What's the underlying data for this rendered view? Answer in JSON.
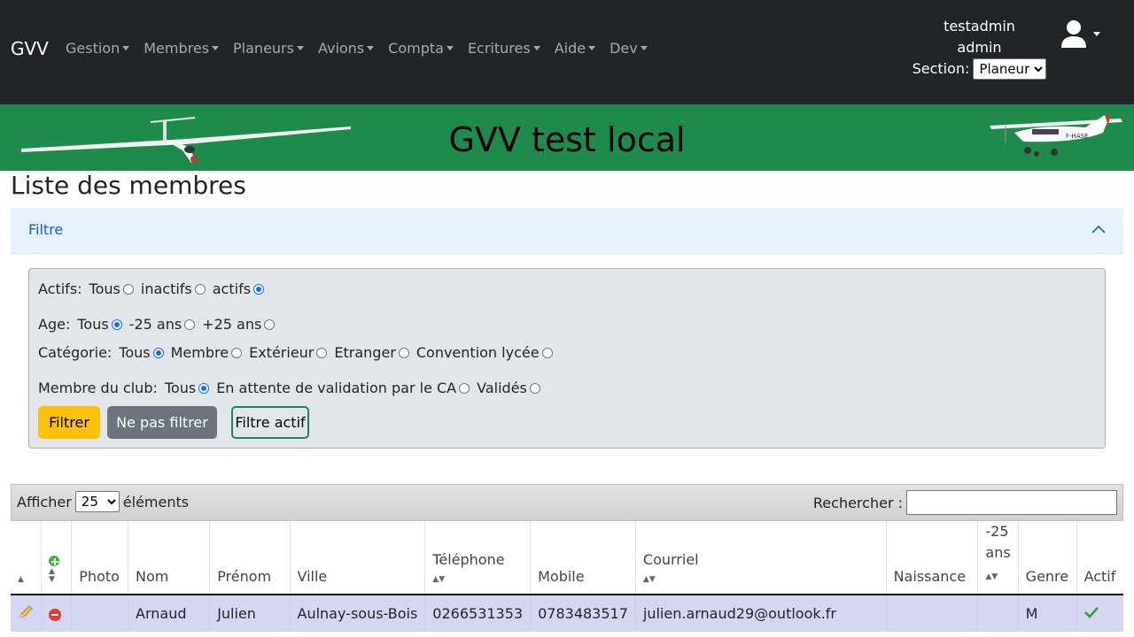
{
  "navbar": {
    "brand": "GVV",
    "menu": [
      "Gestion",
      "Membres",
      "Planeurs",
      "Avions",
      "Compta",
      "Ecritures",
      "Aide",
      "Dev"
    ],
    "user_name": "testadmin",
    "user_role": "admin",
    "section_label": "Section:",
    "section_value": "Planeur"
  },
  "banner": {
    "title": "GVV test local",
    "plane_registration": "F-HASE"
  },
  "page": {
    "title": "Liste des membres"
  },
  "filter": {
    "header": "Filtre",
    "actifs": {
      "label": "Actifs:",
      "options": [
        "Tous",
        "inactifs",
        "actifs"
      ],
      "selected": "actifs"
    },
    "age": {
      "label": "Age:",
      "options": [
        "Tous",
        "-25 ans",
        "+25 ans"
      ],
      "selected": "Tous"
    },
    "categorie": {
      "label": "Catégorie:",
      "options": [
        "Tous",
        "Membre",
        "Extérieur",
        "Etranger",
        "Convention lycée"
      ],
      "selected": "Tous"
    },
    "membre_club": {
      "label": "Membre du club:",
      "options": [
        "Tous",
        "En attente de validation par le CA",
        "Validés"
      ],
      "selected": "Tous"
    },
    "buttons": {
      "filter": "Filtrer",
      "no_filter": "Ne pas filtrer",
      "active": "Filtre actif"
    }
  },
  "table_controls": {
    "show_label": "Afficher",
    "show_value": "25",
    "elements_label": "éléments",
    "search_label": "Rechercher :"
  },
  "table": {
    "headers": [
      "Photo",
      "Nom",
      "Prénom",
      "Ville",
      "Téléphone",
      "Mobile",
      "Courriel",
      "Naissance",
      "-25 ans",
      "Genre",
      "Actif"
    ],
    "rows": [
      {
        "nom": "Arnaud",
        "prenom": "Julien",
        "ville": "Aulnay-sous-Bois",
        "telephone": "0266531353",
        "mobile": "0783483517",
        "courriel": "julien.arnaud29@outlook.fr",
        "naissance": "",
        "moins25": "",
        "genre": "M",
        "actif": true
      }
    ]
  },
  "colors": {
    "navbar": "#212529",
    "banner": "#1e8b4c",
    "filter_btn": "#ffc107",
    "row_highlight": "#d5d7f2"
  }
}
